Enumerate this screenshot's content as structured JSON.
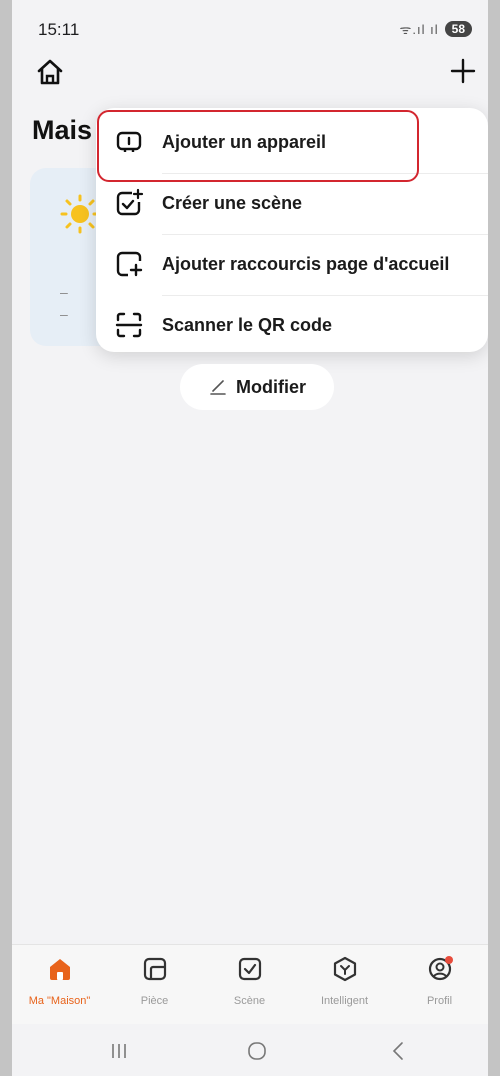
{
  "status_bar": {
    "time": "15:11",
    "signal": "ᯤ.ıl ıl",
    "battery": "58"
  },
  "header": {
    "title": "Mais"
  },
  "menu": {
    "items": [
      {
        "label": "Ajouter un appareil",
        "icon": "add-device-icon"
      },
      {
        "label": "Créer une scène",
        "icon": "create-scene-icon"
      },
      {
        "label": "Ajouter raccourcis page d'accueil",
        "icon": "add-shortcut-icon"
      },
      {
        "label": "Scanner le QR code",
        "icon": "scan-qr-icon"
      }
    ],
    "highlighted_index": 0
  },
  "weather": {
    "line1": "–",
    "line2": "–"
  },
  "modify_button": {
    "label": "Modifier"
  },
  "bottom_nav": {
    "items": [
      {
        "label": "Ma \"Maison\"",
        "icon": "home-icon",
        "active": true
      },
      {
        "label": "Pièce",
        "icon": "room-icon",
        "active": false
      },
      {
        "label": "Scène",
        "icon": "scene-icon",
        "active": false
      },
      {
        "label": "Intelligent",
        "icon": "smart-icon",
        "active": false
      },
      {
        "label": "Profil",
        "icon": "profile-icon",
        "active": false,
        "badge": true
      }
    ]
  },
  "colors": {
    "accent": "#e8631b",
    "highlight": "#d3262f",
    "badge": "#e74c3c"
  }
}
